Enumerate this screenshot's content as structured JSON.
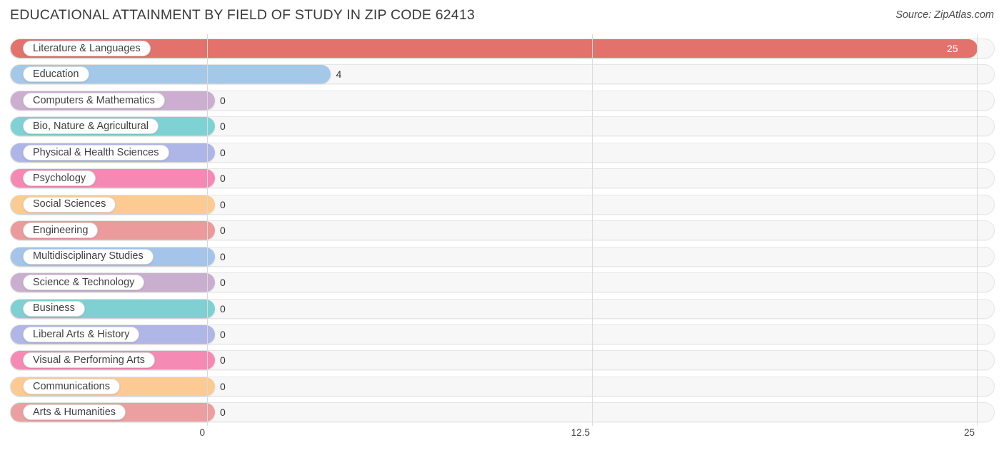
{
  "header": {
    "title": "EDUCATIONAL ATTAINMENT BY FIELD OF STUDY IN ZIP CODE 62413",
    "source": "Source: ZipAtlas.com"
  },
  "chart_data": {
    "type": "bar",
    "orientation": "horizontal",
    "title": "EDUCATIONAL ATTAINMENT BY FIELD OF STUDY IN ZIP CODE 62413",
    "xlabel": "",
    "ylabel": "",
    "xlim": [
      0,
      25
    ],
    "grid": true,
    "legend": "none",
    "tick_labels": [
      "0",
      "12.5",
      "25"
    ],
    "tick_values": [
      0,
      12.5,
      25
    ],
    "categories": [
      "Literature & Languages",
      "Education",
      "Computers & Mathematics",
      "Bio, Nature & Agricultural",
      "Physical & Health Sciences",
      "Psychology",
      "Social Sciences",
      "Engineering",
      "Multidisciplinary Studies",
      "Science & Technology",
      "Business",
      "Liberal Arts & History",
      "Visual & Performing Arts",
      "Communications",
      "Arts & Humanities"
    ],
    "values": [
      25,
      4,
      0,
      0,
      0,
      0,
      0,
      0,
      0,
      0,
      0,
      0,
      0,
      0,
      0
    ],
    "value_labels": [
      "25",
      "4",
      "0",
      "0",
      "0",
      "0",
      "0",
      "0",
      "0",
      "0",
      "0",
      "0",
      "0",
      "0",
      "0"
    ],
    "colors": [
      "#e3726d",
      "#a4c8e8",
      "#cbaed0",
      "#7fd2d4",
      "#aeb6e8",
      "#f589b4",
      "#fbcb92",
      "#eb9b9b",
      "#a4c4ea",
      "#c9aed0",
      "#7fd0d2",
      "#b0b6e6",
      "#f58ab4",
      "#fbcb93",
      "#eb9fa0"
    ]
  }
}
